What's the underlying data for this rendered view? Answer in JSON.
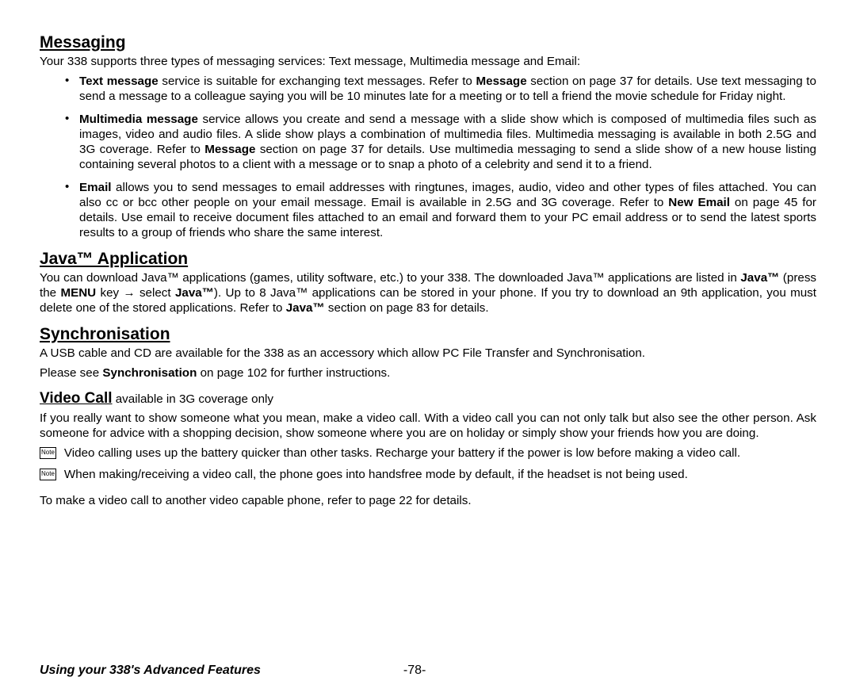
{
  "sections": {
    "messaging": {
      "heading": "Messaging",
      "intro": "Your 338 supports three types of messaging services: Text message, Multimedia message and Email:",
      "bullets": {
        "text_msg_lead_bold": "Text message",
        "text_msg_rest_a": " service is suitable for exchanging text messages. Refer to ",
        "text_msg_bold_b": "Message",
        "text_msg_rest_b": " section on page 37 for details. Use text messaging to send a message to a colleague saying you will be 10 minutes late for a meeting or to tell a friend the movie schedule for Friday night.",
        "mm_lead_bold": "Multimedia message",
        "mm_rest_a": " service allows you create and send a message with a slide show which is composed of multimedia files such as images, video and audio files. A slide show plays a combination of multimedia files. Multimedia messaging is available in both 2.5G and 3G coverage. Refer to ",
        "mm_bold_b": "Message",
        "mm_rest_b": " section on page 37 for details. Use multimedia messaging to send a slide show of a new house listing containing several photos to a client with a message or to snap a photo of a celebrity and send it to a friend.",
        "email_lead_bold": "Email",
        "email_rest_a": " allows you to send messages to email addresses with ringtunes, images, audio, video and other types of files attached. You can also cc or bcc other people on your email message. Email is available in 2.5G and 3G coverage. Refer to ",
        "email_bold_b": "New Email",
        "email_rest_b": " on page 45 for details. Use email to receive document files attached to an email and forward them to your PC email address or to send the latest sports results to a group of friends who share the same interest."
      }
    },
    "java": {
      "heading": "Java™ Application",
      "p_a": "You can download Java™ applications (games, utility software, etc.) to your 338. The downloaded Java™ applications are listed in ",
      "p_bold1": "Java™",
      "p_b": " (press the ",
      "p_bold2": "MENU",
      "p_c": " key ",
      "arrow": "→",
      "p_d": " select ",
      "p_bold3": "Java™",
      "p_e": "). Up to 8 Java™ applications can be stored in your phone. If you try to download an 9th application, you must delete one of the stored applications. Refer to ",
      "p_bold4": "Java™",
      "p_f": " section on page 83 for details."
    },
    "sync": {
      "heading": "Synchronisation",
      "p1": "A USB cable and CD are available for the 338 as an accessory which allow PC File Transfer and Synchronisation.",
      "p2_a": "Please see ",
      "p2_bold": "Synchronisation",
      "p2_b": " on page 102 for further instructions."
    },
    "video": {
      "heading": "Video Call",
      "sub": " available in 3G coverage only",
      "p1": "If you really want to show someone what you mean, make a video call. With a video call you can not only talk but also see the other person. Ask someone for advice with a shopping decision, show someone where you are on holiday or simply show your friends how you are doing.",
      "note1": "Video calling uses up the battery quicker than other tasks. Recharge your battery if the power is low before making a video call.",
      "note2": "When making/receiving a video call, the phone goes into handsfree mode by default, if the headset is not being used.",
      "p2": "To make a video call to another video capable phone, refer to page 22 for details."
    }
  },
  "note_label": "Note",
  "footer": {
    "left": "Using your 338's Advanced Features",
    "page": "-78-"
  }
}
